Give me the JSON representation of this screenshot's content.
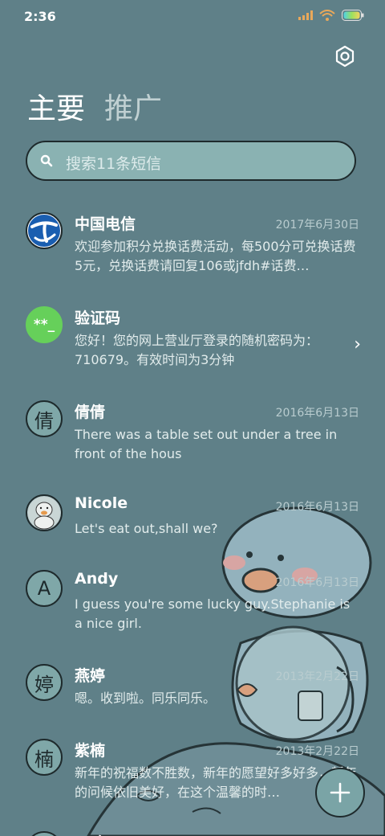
{
  "status_bar": {
    "time": "2:36"
  },
  "tabs": [
    {
      "label": "主要",
      "active": true
    },
    {
      "label": "推广",
      "active": false
    }
  ],
  "search": {
    "placeholder": "搜索11条短信"
  },
  "messages": [
    {
      "avatar_type": "logo",
      "avatar_icon": "china-telecom-logo-icon",
      "name": "中国电信",
      "date": "2017年6月30日",
      "preview": "欢迎参加积分兑换话费活动，每500分可兑换话费5元，兑换话费请回复106或jfdh#话费…"
    },
    {
      "avatar_type": "text-green",
      "avatar_text": "**_",
      "name": "验证码",
      "date": "",
      "preview": "您好！您的网上营业厅登录的随机密码为：710679。有效时间为3分钟",
      "chevron": "›"
    },
    {
      "avatar_type": "letter",
      "avatar_text": "倩",
      "name": "倩倩",
      "date": "2016年6月13日",
      "preview": "There was a table set out under a tree in front of the hous"
    },
    {
      "avatar_type": "photo",
      "avatar_icon": "duck-photo-icon",
      "name": "Nicole",
      "date": "2016年6月13日",
      "preview": "Let's eat out,shall we?"
    },
    {
      "avatar_type": "letter",
      "avatar_text": "A",
      "name": "Andy",
      "date": "2016年6月13日",
      "preview": "I guess you're some lucky guy.Stephanie is a nice girl."
    },
    {
      "avatar_type": "letter",
      "avatar_text": "婷",
      "name": "燕婷",
      "date": "2013年2月22日",
      "preview": "嗯。收到啦。同乐同乐。"
    },
    {
      "avatar_type": "letter",
      "avatar_text": "楠",
      "name": "紫楠",
      "date": "2013年2月22日",
      "preview": "新年的祝福数不胜数，新年的愿望好多好多，新年的问候依旧美好，在这个温馨的时…"
    },
    {
      "avatar_type": "letter",
      "avatar_text": "",
      "name": "子玲",
      "date": "",
      "preview": ""
    }
  ],
  "colors": {
    "background": "#5f8088",
    "search_fill": "#8ab2b2",
    "outline": "#1e2a2c"
  }
}
